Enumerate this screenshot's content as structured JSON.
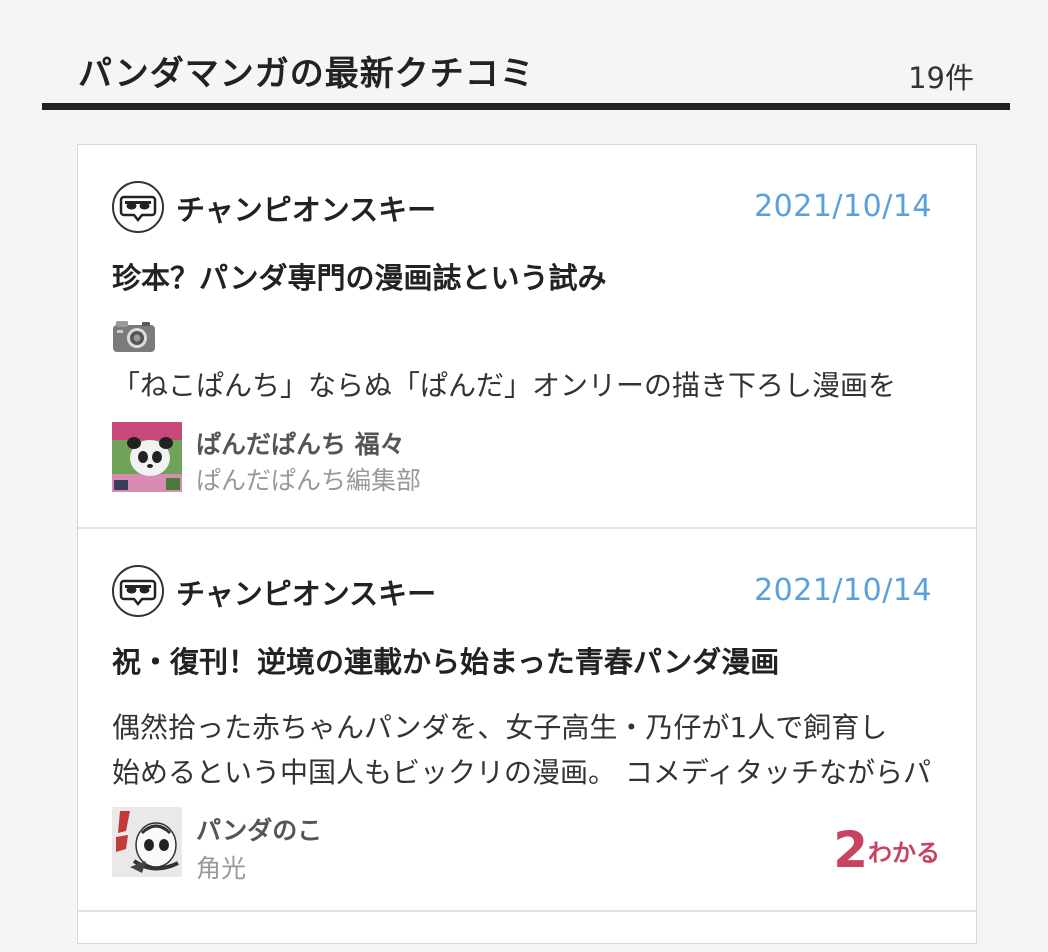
{
  "header": {
    "title": "パンダマンガの最新クチコミ",
    "count": "19件"
  },
  "reviews": [
    {
      "user": "チャンピオンスキー",
      "date": "2021/10/14",
      "title": "珍本？パンダ専門の漫画誌という試み",
      "has_photo_icon": true,
      "body": [
        "「ねこぱんち」ならぬ「ぱんだ」オンリーの描き下ろし漫画を"
      ],
      "book_title": "ぱんだぱんち 福々",
      "book_author": "ぱんだぱんち編集部"
    },
    {
      "user": "チャンピオンスキー",
      "date": "2021/10/14",
      "title": "祝・復刊！逆境の連載から始まった青春パンダ漫画",
      "has_photo_icon": false,
      "body": [
        "偶然拾った赤ちゃんパンダを、女子高生・乃仔が1人で飼育し",
        "始めるという中国人もビックリの漫画。 コメディタッチながらパ"
      ],
      "book_title": "パンダのこ",
      "book_author": "角光",
      "like_count": "2",
      "like_label": "わかる"
    }
  ],
  "icons": {
    "avatar": "sunglasses-speech-bubble-icon",
    "photo": "camera-icon"
  },
  "colors": {
    "date": "#5aa0dc",
    "like": "#c8435f",
    "header_rule": "#222222"
  }
}
